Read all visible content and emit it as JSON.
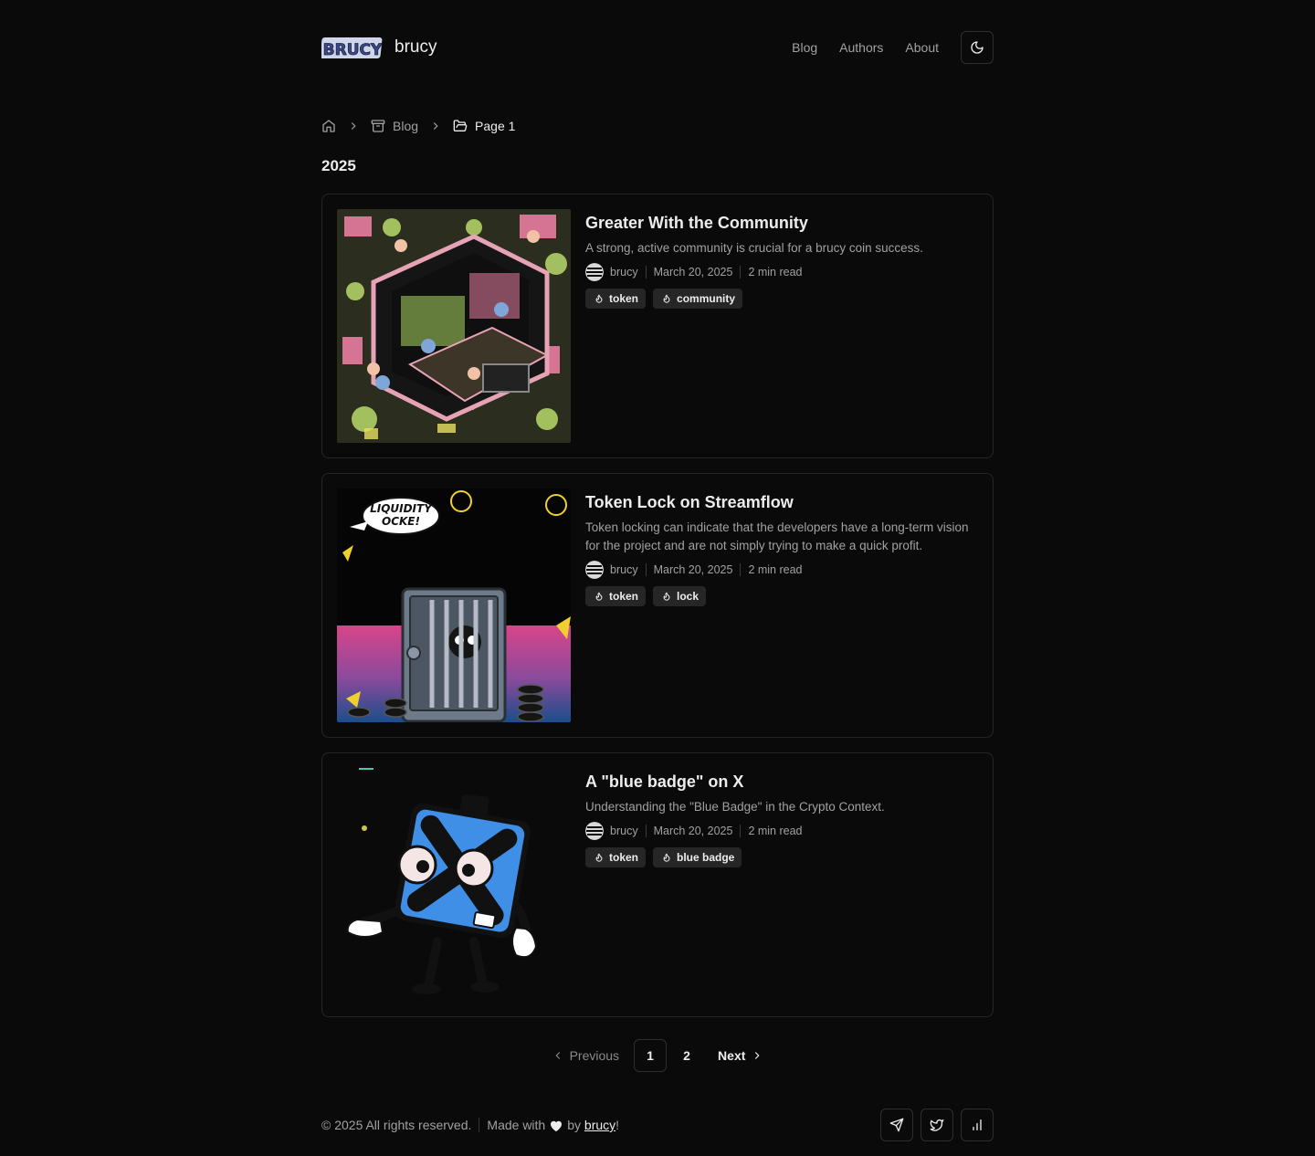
{
  "brand": {
    "logo_text": "BRUCY",
    "name": "brucy"
  },
  "nav": {
    "items": [
      {
        "label": "Blog"
      },
      {
        "label": "Authors"
      },
      {
        "label": "About"
      }
    ],
    "theme_icon": "moon-icon"
  },
  "breadcrumb": {
    "home_icon": "home-icon",
    "blog_label": "Blog",
    "current_label": "Page 1"
  },
  "year_heading": "2025",
  "posts": [
    {
      "title": "Greater With the Community",
      "description": "A strong, active community is crucial for a brucy coin success.",
      "author": "brucy",
      "date": "March 20, 2025",
      "read_time": "2 min read",
      "tags": [
        "token",
        "community"
      ]
    },
    {
      "title": "Token Lock on Streamflow",
      "description": "Token locking can indicate that the developers have a long-term vision for the project and are not simply trying to make a quick profit.",
      "author": "brucy",
      "date": "March 20, 2025",
      "read_time": "2 min read",
      "tags": [
        "token",
        "lock"
      ],
      "image_text": [
        "LIQUIDITY",
        "OCKE!"
      ]
    },
    {
      "title": "A \"blue badge\" on X",
      "description": "Understanding the \"Blue Badge\" in the Crypto Context.",
      "author": "brucy",
      "date": "March 20, 2025",
      "read_time": "2 min read",
      "tags": [
        "token",
        "blue badge"
      ]
    }
  ],
  "pagination": {
    "previous": "Previous",
    "pages": [
      "1",
      "2"
    ],
    "current": "1",
    "next": "Next"
  },
  "footer": {
    "copyright": "© 2025 All rights reserved.",
    "made_with": "Made with",
    "by": "by",
    "author_link": "brucy",
    "suffix": "!",
    "socials": [
      "send-icon",
      "twitter-icon",
      "chart-icon"
    ]
  },
  "colors": {
    "background": "#0a0a0a",
    "border": "#262626",
    "text": "#ededed",
    "muted": "#a1a1a1",
    "tag_bg": "#262626"
  }
}
